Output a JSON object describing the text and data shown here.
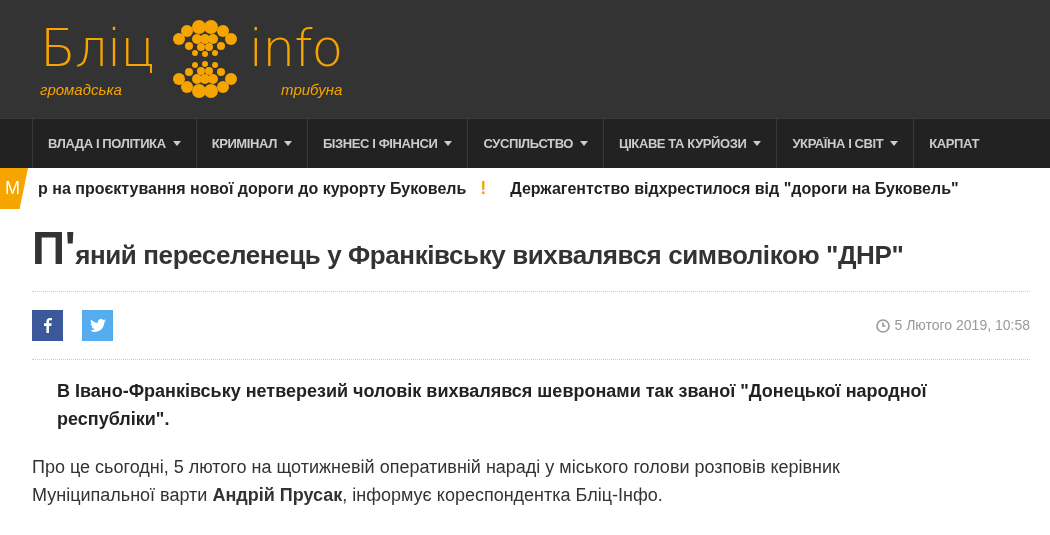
{
  "logo": {
    "word_left": "Бліц",
    "word_right": "info",
    "tagline_left": "громадська",
    "tagline_right": "трибуна"
  },
  "nav": [
    {
      "label": "ВЛАДА І ПОЛІТИКА",
      "has_menu": true
    },
    {
      "label": "КРИМІНАЛ",
      "has_menu": true
    },
    {
      "label": "БІЗНЕС І ФІНАНСИ",
      "has_menu": true
    },
    {
      "label": "СУСПІЛЬСТВО",
      "has_menu": true
    },
    {
      "label": "ЦІКАВЕ ТА КУРЙОЗИ",
      "has_menu": true
    },
    {
      "label": "УКРАЇНА І СВІТ",
      "has_menu": true
    },
    {
      "label": "КАРПАТ",
      "has_menu": false
    }
  ],
  "ticker": {
    "tab": "М",
    "separator": "!",
    "items": [
      "р на проєктування нової дороги до курорту Буковель",
      "Держагентство відхрестилося від \"дороги на Буковель\""
    ]
  },
  "article": {
    "drop_cap": "П'",
    "title": "яний переселенець у Франківську вихвалявся символікою \"ДНР\"",
    "share": [
      {
        "kind": "facebook"
      },
      {
        "kind": "twitter"
      }
    ],
    "date": "5 Лютого 2019, 10:58",
    "lead": "В Івано-Франківську нетверезий чоловік вихвалявся шевронами так званої \"Донецької народної республіки\".",
    "body": "Про це сьогодні, 5 лютого на щотижневій оперативній нараді у міського голови розповів керівник Муніципальної варти **Андрій Прусак**, інформує кореспондентка Бліц-Інфо."
  }
}
